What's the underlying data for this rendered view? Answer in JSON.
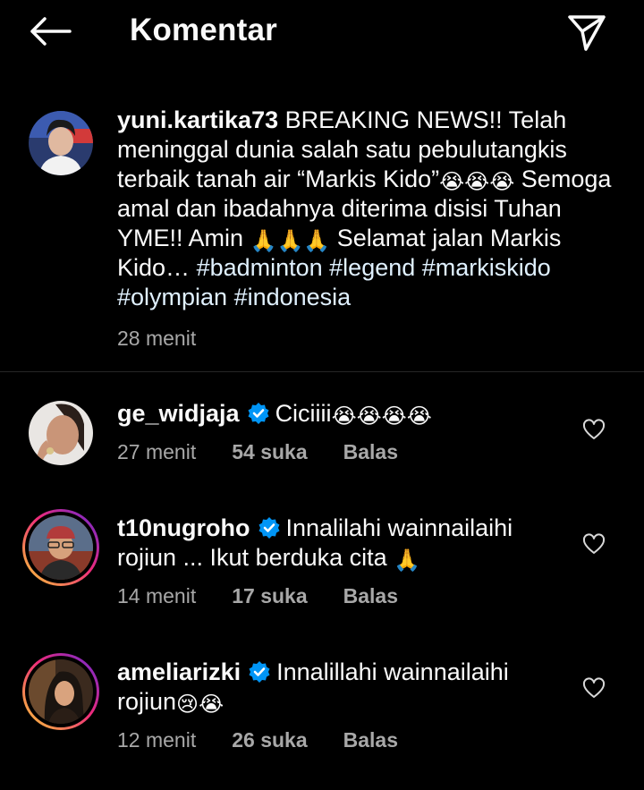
{
  "header": {
    "title": "Komentar"
  },
  "icons": {
    "back": "arrow-left-icon",
    "send": "paper-plane-icon",
    "verified": "verified-badge-icon",
    "heart": "heart-icon"
  },
  "colors": {
    "background": "#000000",
    "text": "#fafafa",
    "muted": "#a8a8a8",
    "verified": "#0095f6",
    "divider": "#262626"
  },
  "caption": {
    "username": "yuni.kartika73",
    "text_1": "BREAKING NEWS!! Telah meninggal dunia salah satu pebulutangkis terbaik tanah air “Markis Kido”",
    "emoji_1": "😭😭😭",
    "text_2": "Semoga amal dan ibadahnya diterima disisi Tuhan YME!! Amin",
    "emoji_2": "🙏🙏🙏",
    "text_3": "Selamat jalan Markis Kido…",
    "hashtags": "#badminton #legend #markiskido #olympian #indonesia",
    "time": "28 menit"
  },
  "comments": [
    {
      "username": "ge_widjaja",
      "text": "Ciciiii",
      "emoji": "😭😭😭😭",
      "time": "27 menit",
      "likes": "54 suka",
      "reply": "Balas"
    },
    {
      "username": "t10nugroho",
      "text": "Innalilahi wainnailaihi rojiun ... Ikut berduka cita",
      "emoji": "🙏",
      "time": "14 menit",
      "likes": "17 suka",
      "reply": "Balas"
    },
    {
      "username": "ameliarizki",
      "text": "Innalillahi wainnailaihi rojiun",
      "emoji": "😢😭",
      "time": "12 menit",
      "likes": "26 suka",
      "reply": "Balas"
    }
  ]
}
